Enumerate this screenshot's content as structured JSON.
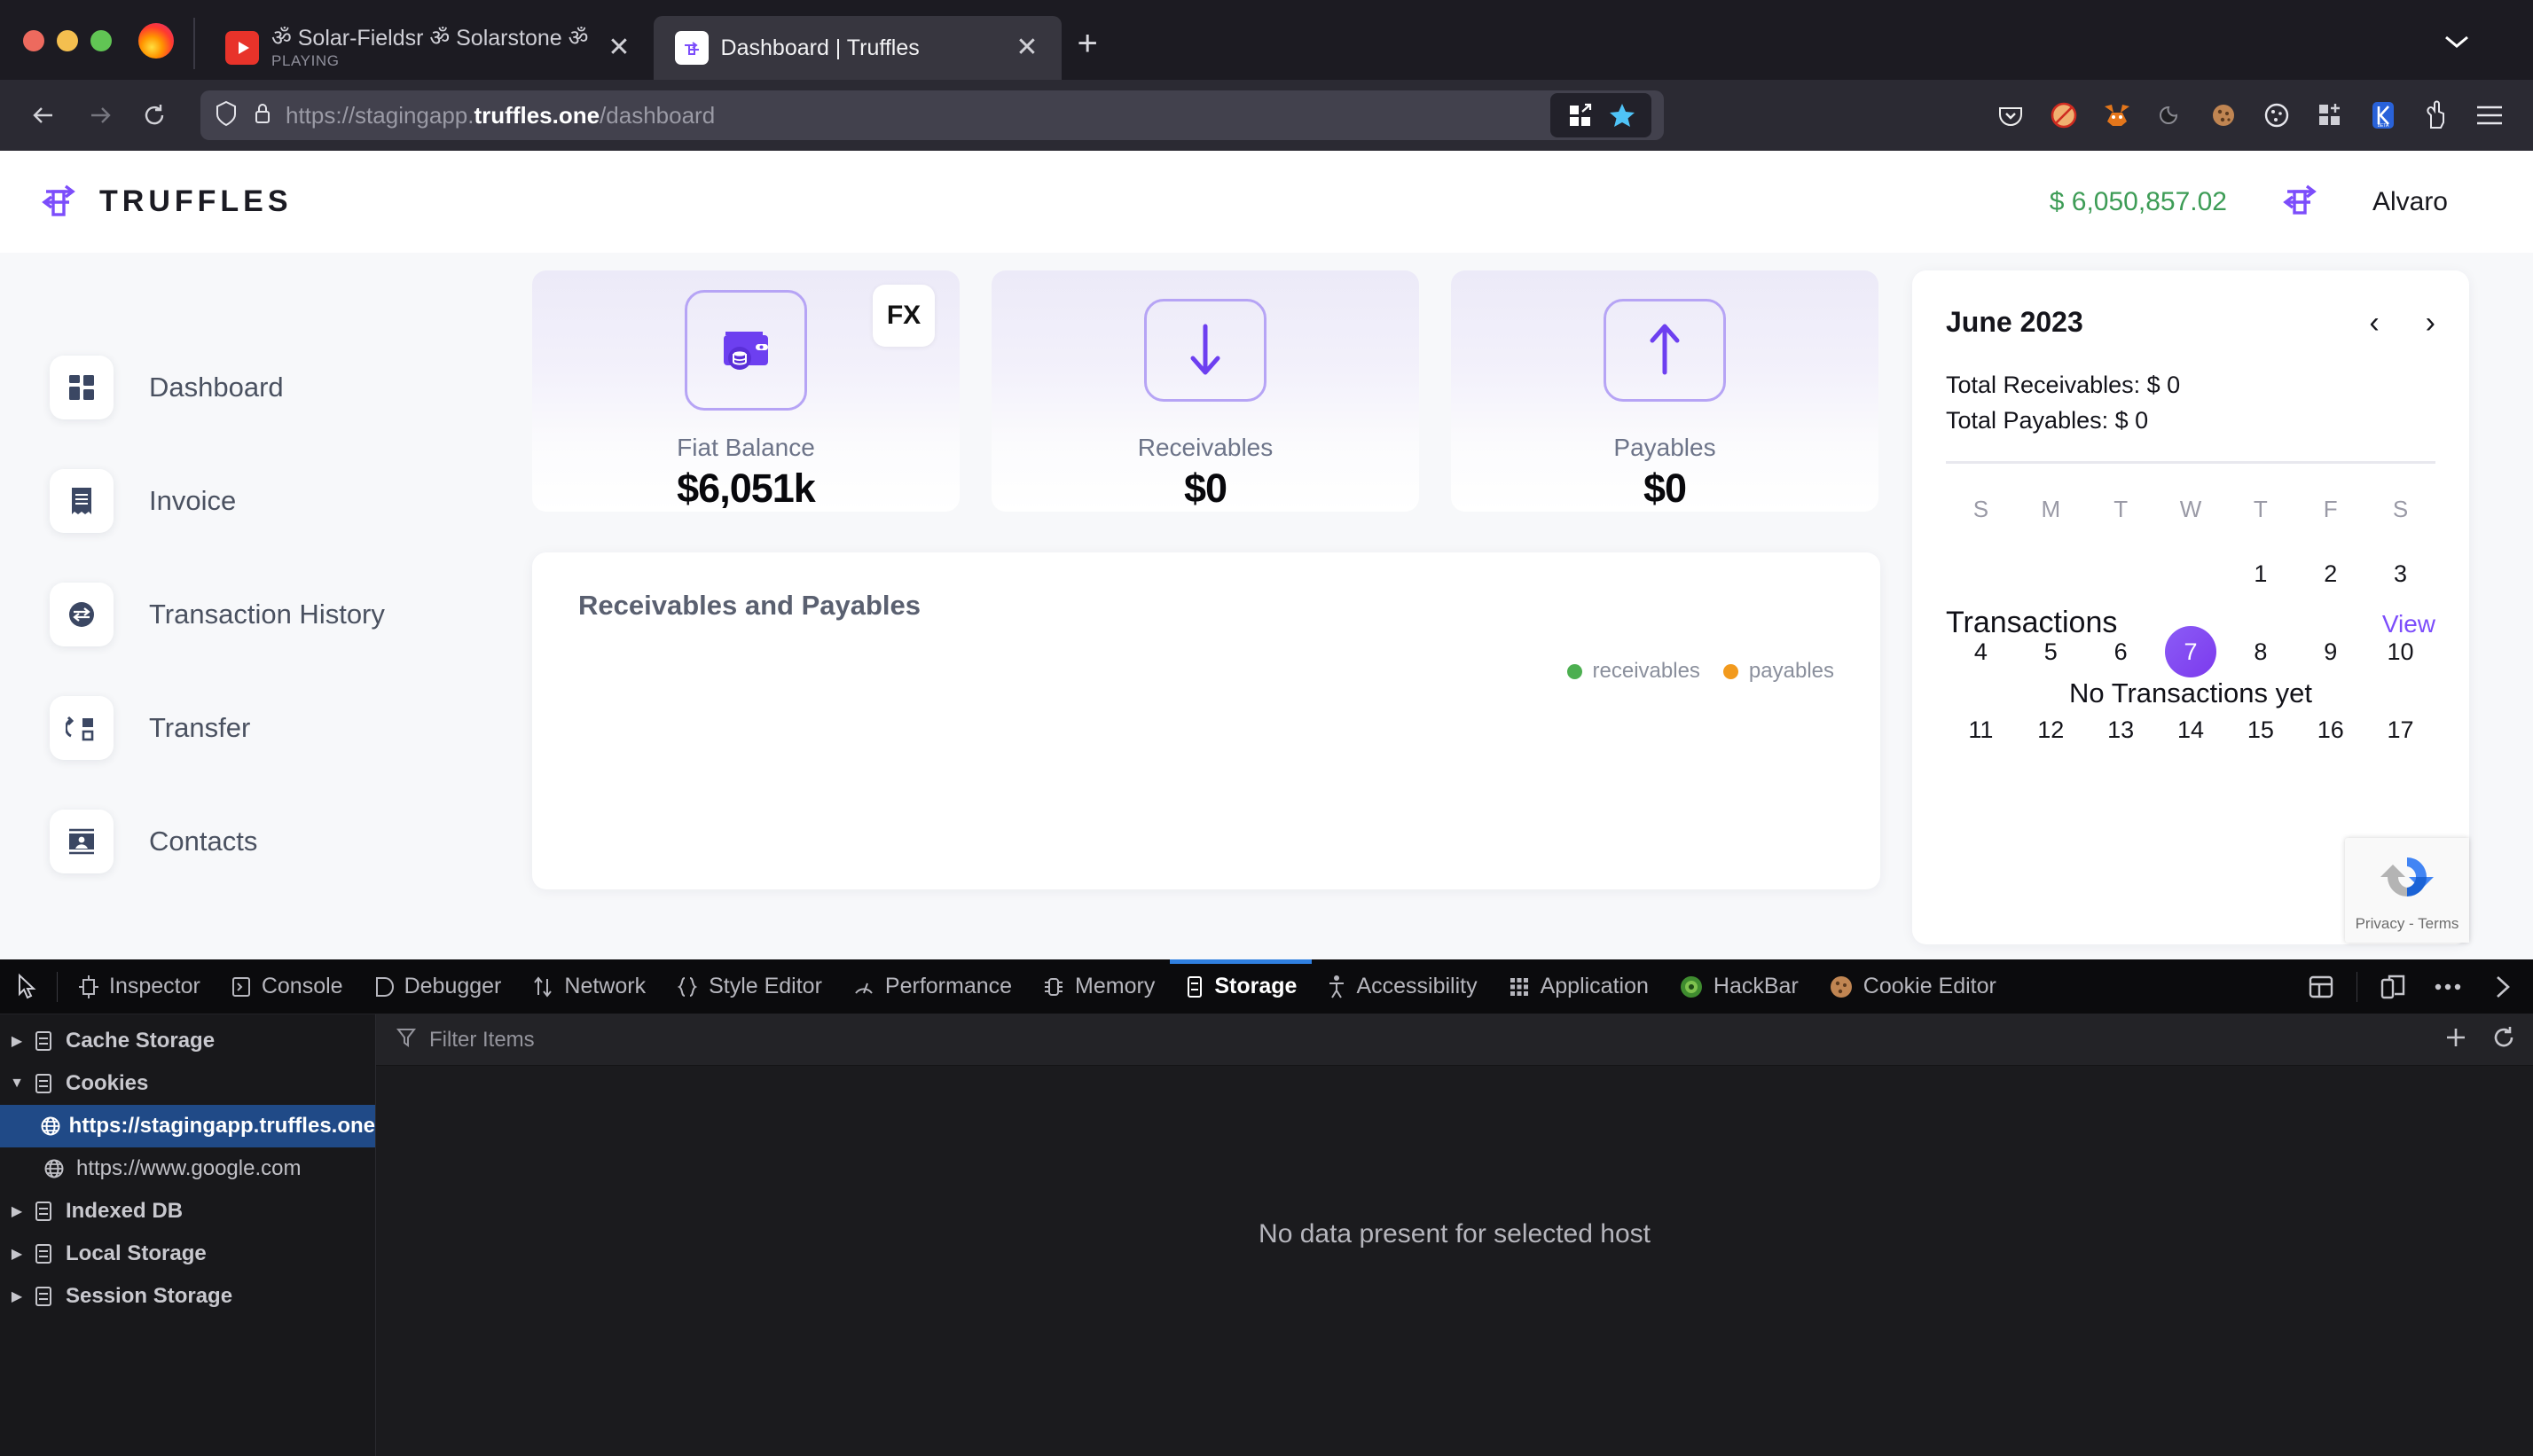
{
  "browser": {
    "tabs": [
      {
        "title": "ॐ Solar-Fieldsr ॐ Solarstone ॐ",
        "subtitle": "PLAYING",
        "favicon": "youtube-icon",
        "active": false
      },
      {
        "title": "Dashboard | Truffles",
        "subtitle": "",
        "favicon": "truffles-icon",
        "active": true
      }
    ],
    "new_tab_label": "+",
    "close_label": "✕",
    "nav": {
      "back": "←",
      "forward": "→",
      "reload": "⟳"
    },
    "url": {
      "scheme": "https://",
      "host_plain": "stagingapp.",
      "host_bold": "truffles.one",
      "path": "/dashboard"
    },
    "shield_icon": "shield-icon",
    "lock_icon": "lock-icon",
    "extensions": [
      "container-tabs-icon",
      "bookmark-star-icon",
      "pocket-icon",
      "noscript-icon",
      "metamask-icon",
      "dark-reader-icon",
      "cookie-icon",
      "cookie-editor-icon",
      "add-extension-icon",
      "kee-beta-icon",
      "ublock-icon",
      "app-menu-icon"
    ]
  },
  "app": {
    "brand": "TRUFFLES",
    "balance": "$ 6,050,857.02",
    "username": "Alvaro",
    "sidebar": {
      "items": [
        {
          "label": "Dashboard",
          "icon": "dashboard-grid-icon"
        },
        {
          "label": "Invoice",
          "icon": "invoice-receipt-icon"
        },
        {
          "label": "Transaction History",
          "icon": "transaction-exchange-icon"
        },
        {
          "label": "Transfer",
          "icon": "transfer-arrow-icon"
        },
        {
          "label": "Contacts",
          "icon": "contacts-card-icon"
        }
      ]
    },
    "cards": [
      {
        "label": "Fiat Balance",
        "value": "$6,051k",
        "icon": "wallet-icon",
        "badge": "FX"
      },
      {
        "label": "Receivables",
        "value": "$0",
        "icon": "arrow-down-icon",
        "badge": ""
      },
      {
        "label": "Payables",
        "value": "$0",
        "icon": "arrow-up-icon",
        "badge": ""
      }
    ],
    "chart": {
      "title": "Receivables and Payables",
      "legend": [
        {
          "label": "receivables",
          "color": "#4caf50"
        },
        {
          "label": "payables",
          "color": "#f29a1d"
        }
      ]
    },
    "calendar": {
      "month": "June 2023",
      "prev": "‹",
      "next": "›",
      "total_receivables": "Total Receivables: $ 0",
      "total_payables": "Total Payables: $ 0",
      "dow": [
        "S",
        "M",
        "T",
        "W",
        "T",
        "F",
        "S"
      ],
      "blanks_before": 4,
      "days": [
        1,
        2,
        3,
        4,
        5,
        6,
        7,
        8,
        9,
        10,
        11,
        12,
        13,
        14,
        15,
        16,
        17
      ],
      "selected_day": 7,
      "accent": "#7c4dfb"
    },
    "transactions": {
      "title": "Transactions",
      "view_all": "View",
      "empty": "No Transactions yet"
    },
    "recaptcha": {
      "terms": "Privacy - Terms",
      "icon": "recaptcha-icon"
    }
  },
  "chart_data": {
    "type": "line",
    "title": "Receivables and Payables",
    "categories": [],
    "series": [
      {
        "name": "receivables",
        "values": [],
        "color": "#4caf50"
      },
      {
        "name": "payables",
        "values": [],
        "color": "#f29a1d"
      }
    ],
    "xlabel": "",
    "ylabel": "",
    "legend_position": "bottom-right",
    "grid": false,
    "note": "Plot area is occluded by the devtools panel; only title and legend are visible."
  },
  "devtools": {
    "picker_icon": "element-picker-icon",
    "tabs": [
      {
        "label": "Inspector",
        "icon": "inspector-icon",
        "active": false
      },
      {
        "label": "Console",
        "icon": "console-icon",
        "active": false
      },
      {
        "label": "Debugger",
        "icon": "debugger-icon",
        "active": false
      },
      {
        "label": "Network",
        "icon": "network-icon",
        "active": false
      },
      {
        "label": "Style Editor",
        "icon": "style-editor-icon",
        "active": false
      },
      {
        "label": "Performance",
        "icon": "performance-icon",
        "active": false
      },
      {
        "label": "Memory",
        "icon": "memory-icon",
        "active": false
      },
      {
        "label": "Storage",
        "icon": "storage-icon",
        "active": true
      },
      {
        "label": "Accessibility",
        "icon": "accessibility-icon",
        "active": false
      },
      {
        "label": "Application",
        "icon": "application-icon",
        "active": false
      },
      {
        "label": "HackBar",
        "icon": "hackbar-icon",
        "active": false
      },
      {
        "label": "Cookie Editor",
        "icon": "cookie-editor-icon",
        "active": false
      }
    ],
    "right_icons": [
      "split-console-icon",
      "responsive-design-icon",
      "meatball-menu-icon",
      "close-devtools-icon"
    ],
    "tree": [
      {
        "label": "Cache Storage",
        "icon": "storage-db-icon",
        "expanded": false,
        "child": false,
        "selected": false
      },
      {
        "label": "Cookies",
        "icon": "storage-db-icon",
        "expanded": true,
        "child": false,
        "selected": false
      },
      {
        "label": "https://stagingapp.truffles.one",
        "icon": "globe-icon",
        "child": true,
        "selected": true
      },
      {
        "label": "https://www.google.com",
        "icon": "globe-icon",
        "child": true,
        "selected": false
      },
      {
        "label": "Indexed DB",
        "icon": "storage-db-icon",
        "expanded": false,
        "child": false,
        "selected": false
      },
      {
        "label": "Local Storage",
        "icon": "storage-db-icon",
        "expanded": false,
        "child": false,
        "selected": false
      },
      {
        "label": "Session Storage",
        "icon": "storage-db-icon",
        "expanded": false,
        "child": false,
        "selected": false
      }
    ],
    "filter_placeholder": "Filter Items",
    "filter_icon": "filter-funnel-icon",
    "add_item_label": "+",
    "refresh_label": "⟳",
    "empty_message": "No data present for selected host"
  }
}
